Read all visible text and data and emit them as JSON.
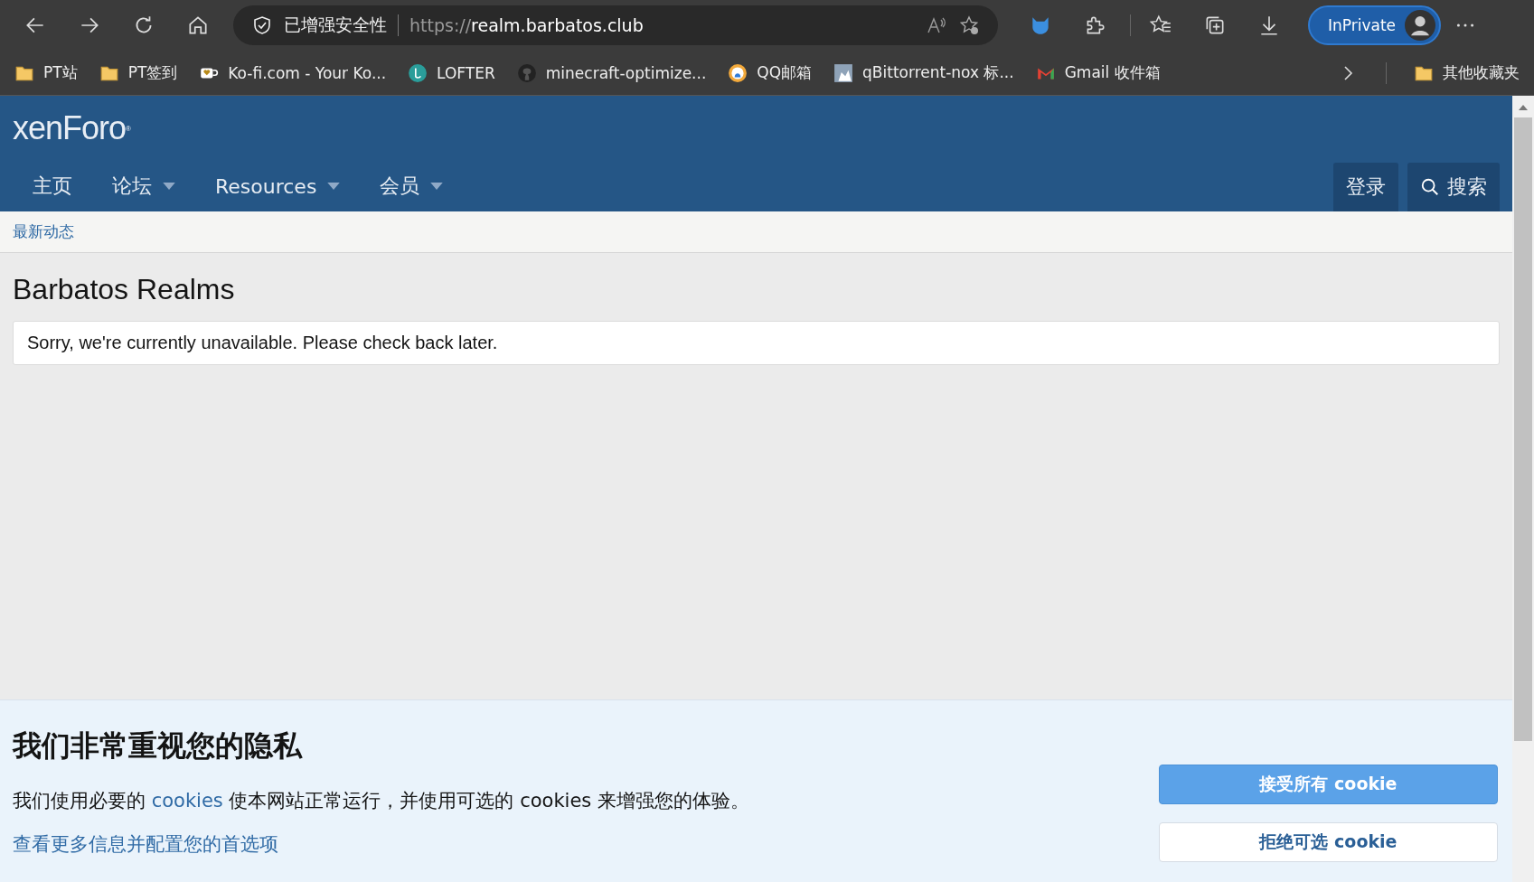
{
  "browser": {
    "security_label": "已增强安全性",
    "url_scheme": "https://",
    "url_host": "realm.barbatos.club",
    "profile_label": "InPrivate"
  },
  "bookmarks": [
    {
      "label": "PT站",
      "kind": "folder"
    },
    {
      "label": "PT签到",
      "kind": "folder"
    },
    {
      "label": "Ko-fi.com - Your Ko...",
      "kind": "cup"
    },
    {
      "label": "LOFTER",
      "kind": "teal"
    },
    {
      "label": "minecraft-optimize...",
      "kind": "github"
    },
    {
      "label": "QQ邮箱",
      "kind": "qq"
    },
    {
      "label": "qBittorrent-nox 标...",
      "kind": "image"
    },
    {
      "label": "Gmail 收件箱",
      "kind": "gmail"
    }
  ],
  "other_bookmarks": "其他收藏夹",
  "site": {
    "logo": "xenForo$^{®}$",
    "nav": [
      {
        "label": "主页",
        "dropdown": false
      },
      {
        "label": "论坛",
        "dropdown": true
      },
      {
        "label": "Resources",
        "dropdown": true
      },
      {
        "label": "会员",
        "dropdown": true
      }
    ],
    "login": "登录",
    "search": "搜索",
    "subnav": "最新动态",
    "title": "Barbatos Realms",
    "message": "Sorry, we're currently unavailable. Please check back later."
  },
  "cookie_notice": {
    "heading": "我们非常重视您的隐私",
    "text_before": "我们使用必要的 ",
    "link": "cookies",
    "text_after": " 使本网站正常运行，并使用可选的 cookies 来增强您的体验。",
    "more": "查看更多信息并配置您的首选项",
    "accept": "接受所有 cookie",
    "reject": "拒绝可选 cookie"
  }
}
